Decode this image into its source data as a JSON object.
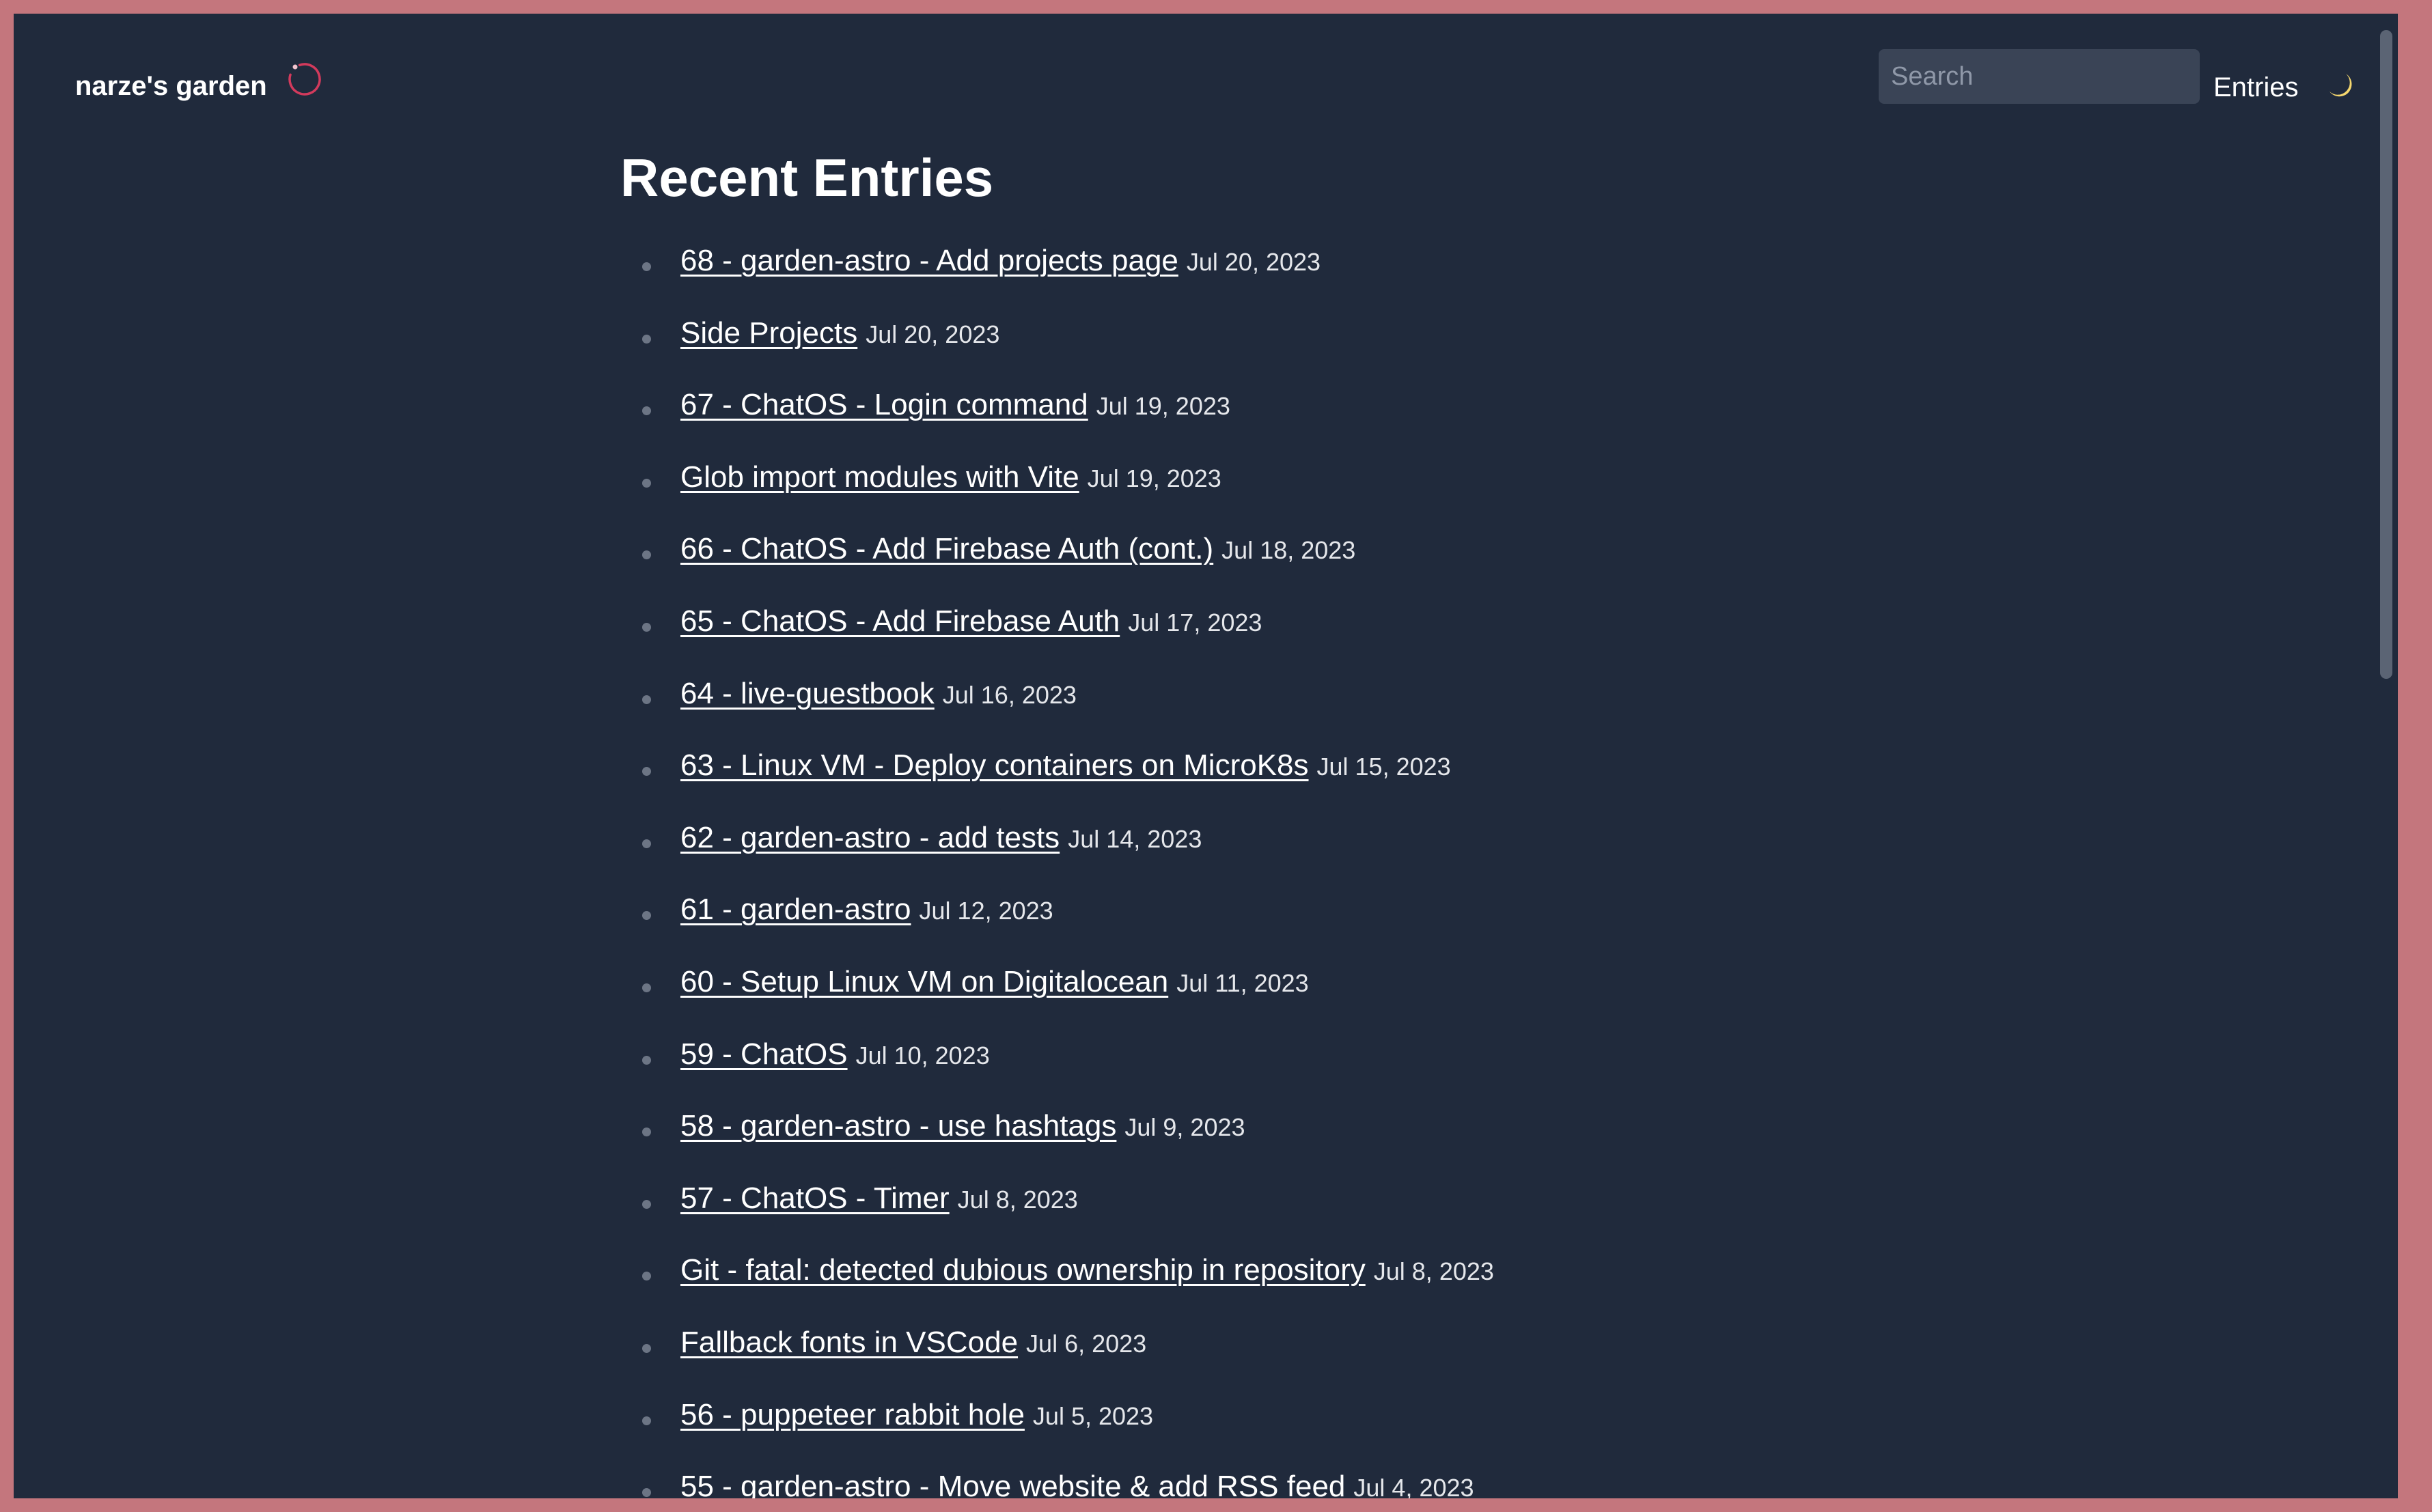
{
  "header": {
    "site_title": "narze's garden",
    "search_placeholder": "Search",
    "nav_entries_label": "Entries",
    "logo_icon": "ring-logo-icon",
    "theme_icon": "moon-icon"
  },
  "main": {
    "title": "Recent Entries",
    "entries": [
      {
        "title": "68 - garden-astro - Add projects page",
        "date": "Jul 20, 2023"
      },
      {
        "title": "Side Projects",
        "date": "Jul 20, 2023"
      },
      {
        "title": "67 - ChatOS - Login command",
        "date": "Jul 19, 2023"
      },
      {
        "title": "Glob import modules with Vite",
        "date": "Jul 19, 2023"
      },
      {
        "title": "66 - ChatOS - Add Firebase Auth (cont.)",
        "date": "Jul 18, 2023"
      },
      {
        "title": "65 - ChatOS - Add Firebase Auth",
        "date": "Jul 17, 2023"
      },
      {
        "title": "64 - live-guestbook",
        "date": "Jul 16, 2023"
      },
      {
        "title": "63 - Linux VM - Deploy containers on MicroK8s",
        "date": "Jul 15, 2023"
      },
      {
        "title": "62 - garden-astro - add tests",
        "date": "Jul 14, 2023"
      },
      {
        "title": "61 - garden-astro",
        "date": "Jul 12, 2023"
      },
      {
        "title": "60 - Setup Linux VM on Digitalocean",
        "date": "Jul 11, 2023"
      },
      {
        "title": "59 - ChatOS",
        "date": "Jul 10, 2023"
      },
      {
        "title": "58 - garden-astro - use hashtags",
        "date": "Jul 9, 2023"
      },
      {
        "title": "57 - ChatOS - Timer",
        "date": "Jul 8, 2023"
      },
      {
        "title": "Git - fatal: detected dubious ownership in repository",
        "date": "Jul 8, 2023"
      },
      {
        "title": "Fallback fonts in VSCode",
        "date": "Jul 6, 2023"
      },
      {
        "title": "56 - puppeteer rabbit hole",
        "date": "Jul 5, 2023"
      },
      {
        "title": "55 - garden-astro - Move website & add RSS feed",
        "date": "Jul 4, 2023"
      }
    ]
  },
  "colors": {
    "background": "#202a3c",
    "frame": "#c4767d",
    "text": "#ffffff",
    "logo_accent": "#d23a5c",
    "moon": "#f5d76e"
  }
}
